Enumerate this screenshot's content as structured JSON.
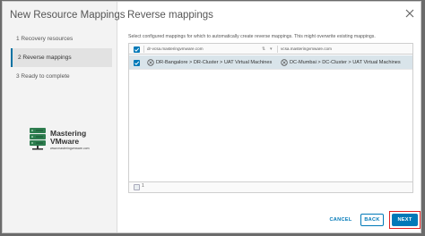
{
  "wizard": {
    "title": "New Resource Mappings",
    "steps": [
      {
        "label": "1   Recovery resources",
        "active": false
      },
      {
        "label": "2   Reverse mappings",
        "active": true
      },
      {
        "label": "3   Ready to complete",
        "active": false
      }
    ]
  },
  "logo": {
    "line1": "Mastering",
    "line2": "VMware",
    "url": "www.masteringvmware.com"
  },
  "page": {
    "title": "Reverse mappings",
    "description": "Select configured mappings for which to automatically create reverse mappings. This might overwrite existing mappings."
  },
  "grid": {
    "columns": [
      "dr-vcsa.masteringvmware.com",
      "vcsa.masteringvmware.com"
    ],
    "rows": [
      {
        "checked": true,
        "source": "DR-Bangalore > DR-Cluster > UAT Virtual Machines",
        "target": "DC-Mumbai > DC-Cluster > UAT Virtual Machines"
      }
    ],
    "footer_count": "1"
  },
  "buttons": {
    "cancel": "CANCEL",
    "back": "BACK",
    "next": "NEXT"
  },
  "colors": {
    "accent": "#0079b8",
    "selected_row": "#d9e4ea",
    "highlight": "#e02020"
  }
}
